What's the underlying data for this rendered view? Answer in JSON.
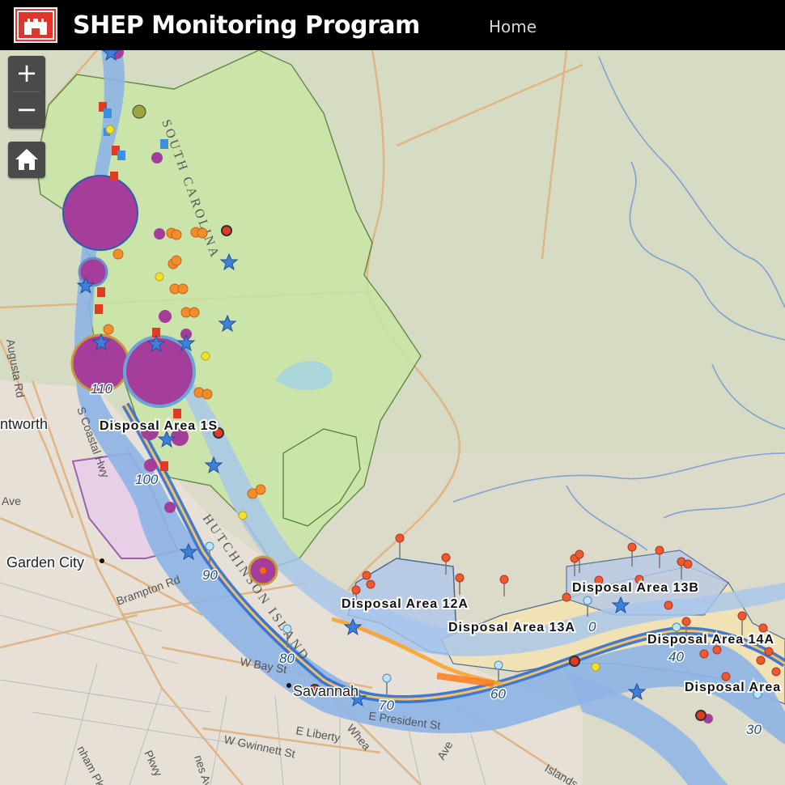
{
  "header": {
    "title": "SHEP Monitoring Program",
    "home_label": "Home",
    "logo_icon": "usace-castle-icon"
  },
  "controls": {
    "zoom_in": "+",
    "zoom_out": "−",
    "home_icon": "home-icon"
  },
  "map": {
    "disposal_areas": [
      "Disposal Area 1S",
      "Disposal Area 12A",
      "Disposal Area 13A",
      "Disposal Area 13B",
      "Disposal Area 14A",
      "Disposal Area"
    ],
    "river_miles": [
      "110",
      "100",
      "90",
      "80",
      "70",
      "60",
      "40",
      "30"
    ],
    "river_mile_fragment": "0",
    "places": [
      "Garden City",
      "Savannah",
      "ntworth"
    ],
    "roads": [
      "Augusta Rd",
      "S Coastal Hwy",
      "Ave",
      "Brampton Rd",
      "W Bay St",
      "E President St",
      "E Liberty",
      "W Gwinnett St",
      "Whea",
      "Ave",
      "Pkwy",
      "nes Ave",
      "nham Pky",
      "Islands"
    ],
    "region_labels": [
      "SOUTH CAROLINA",
      "HUTCHINSON ISLAND"
    ],
    "colors": {
      "header_bg": "#000000",
      "logo_red": "#e1352b",
      "refuge_green": "#c8e6a6",
      "river_blue": "#7fa9e0",
      "channel_blue": "#2f6fd0",
      "disposal_blue": "#b6c9e8",
      "disposal_tan": "#f3e3b3",
      "station_purple": "#a53d9a",
      "marker_orange": "#f28d2b",
      "star_blue": "#3d7fd9"
    }
  }
}
